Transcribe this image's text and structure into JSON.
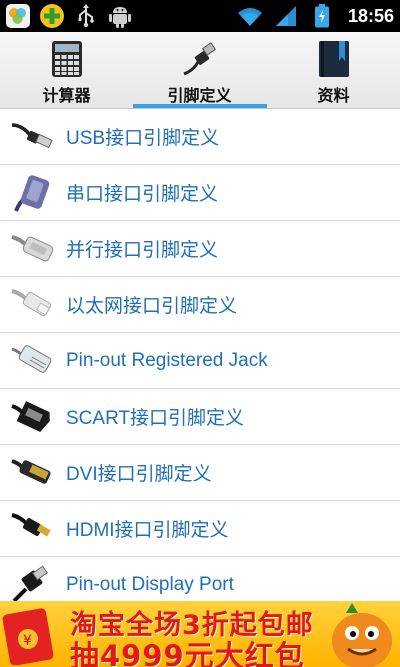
{
  "status_bar": {
    "time": "18:56",
    "left_icons": [
      "photo-app-icon",
      "plus-app-icon",
      "usb-icon",
      "android-icon"
    ],
    "right_icons": [
      "wifi-icon",
      "signal-icon",
      "battery-icon"
    ]
  },
  "tabs": [
    {
      "label": "计算器",
      "icon": "calculator-icon",
      "selected": false
    },
    {
      "label": "引脚定义",
      "icon": "usb-plug-icon",
      "selected": true
    },
    {
      "label": "资料",
      "icon": "book-icon",
      "selected": false
    }
  ],
  "list_items": [
    {
      "label": "USB接口引脚定义",
      "icon": "usb-cable-icon"
    },
    {
      "label": "串口接口引脚定义",
      "icon": "serial-connector-icon"
    },
    {
      "label": "并行接口引脚定义",
      "icon": "parallel-connector-icon"
    },
    {
      "label": "以太网接口引脚定义",
      "icon": "ethernet-connector-icon"
    },
    {
      "label": "Pin-out Registered Jack",
      "icon": "rj-jack-icon"
    },
    {
      "label": "SCART接口引脚定义",
      "icon": "scart-connector-icon"
    },
    {
      "label": "DVI接口引脚定义",
      "icon": "dvi-connector-icon"
    },
    {
      "label": "HDMI接口引脚定义",
      "icon": "hdmi-connector-icon"
    },
    {
      "label": "Pin-out Display Port",
      "icon": "displayport-connector-icon"
    }
  ],
  "ad": {
    "line1": "淘宝全场3折起包邮",
    "line2": "抽4999元大红包"
  },
  "colors": {
    "accent": "#3aa1e2",
    "link_text": "#1f6fb9",
    "ad_text": "#e01818",
    "ad_bg": "#ffc61e"
  }
}
